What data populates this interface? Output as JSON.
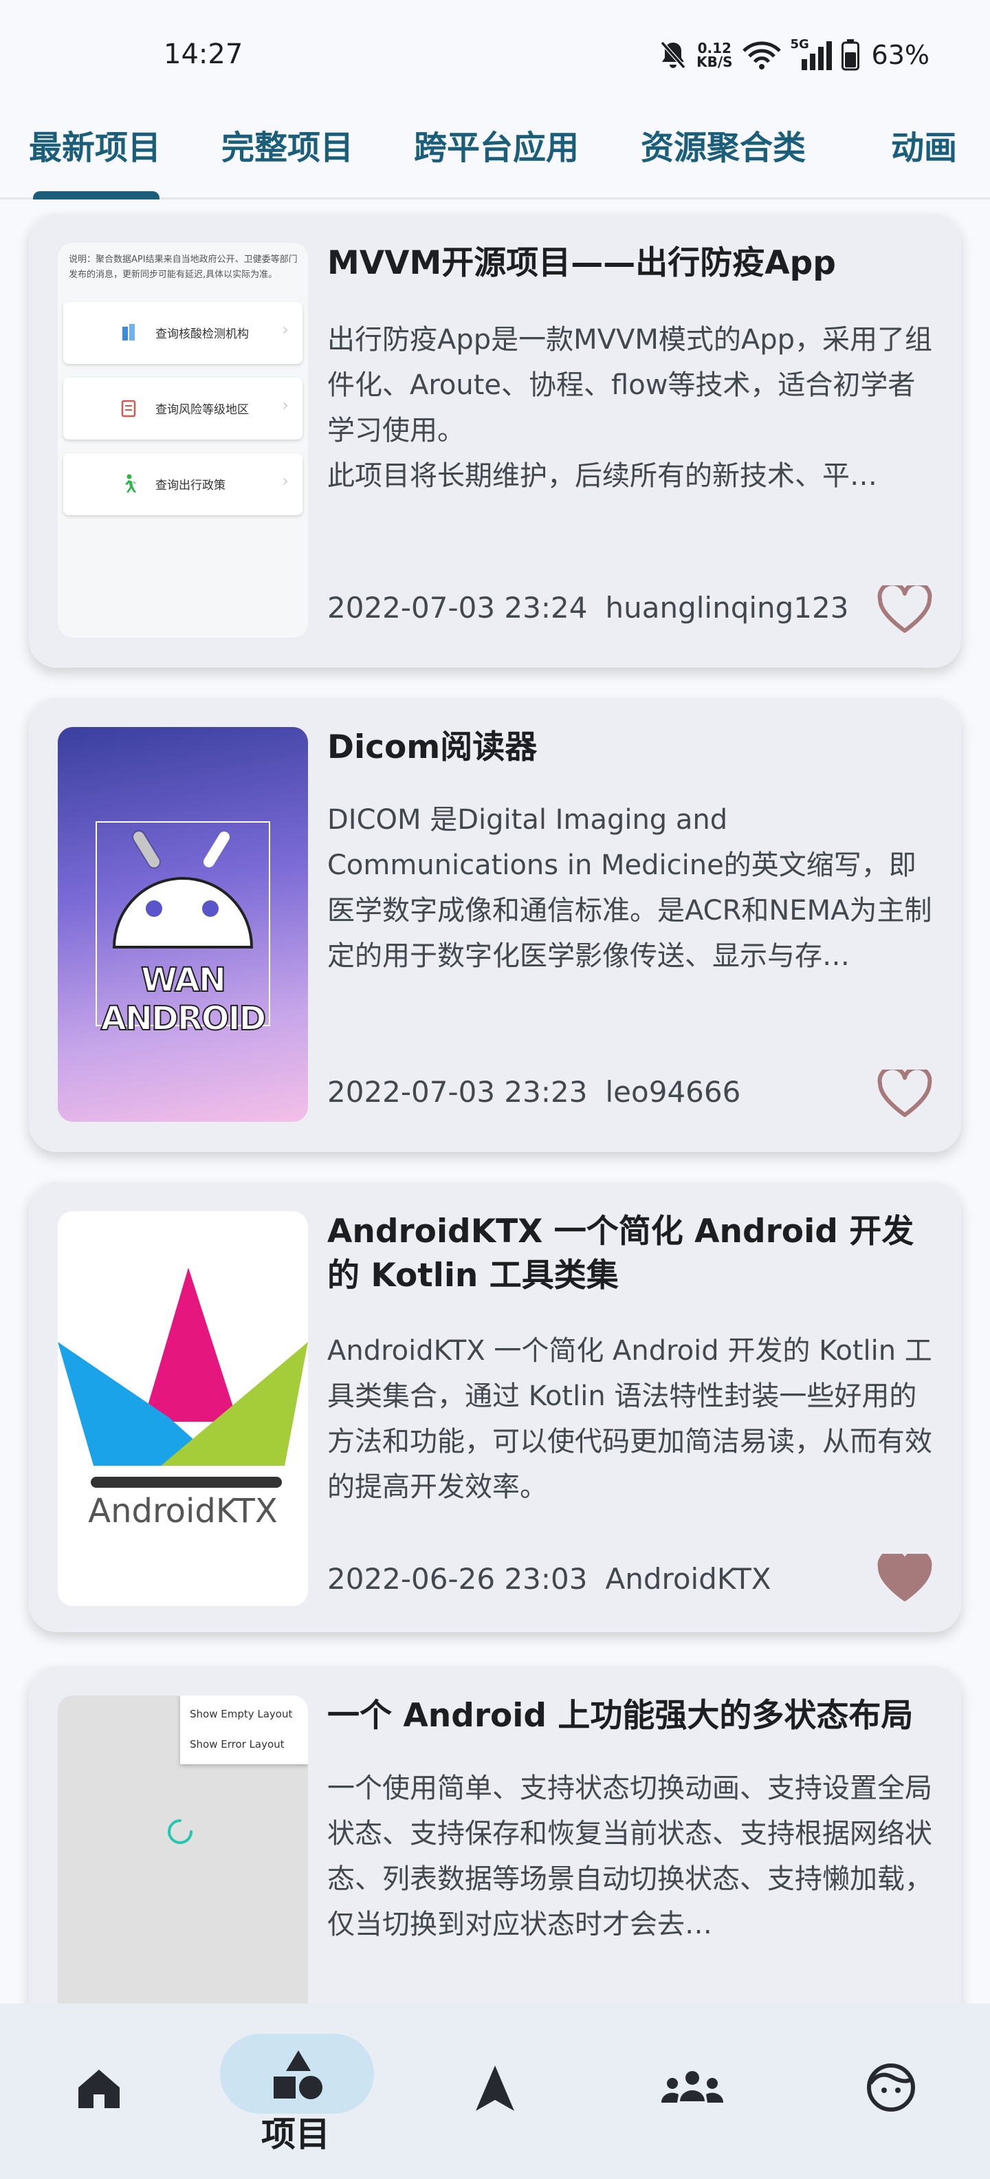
{
  "status_bar": {
    "time": "14:27",
    "net_speed_value": "0.12",
    "net_speed_unit": "KB/S",
    "cell_label": "5G",
    "battery": "63%"
  },
  "tabs": [
    {
      "label": "最新项目",
      "selected": true
    },
    {
      "label": "完整项目",
      "selected": false
    },
    {
      "label": "跨平台应用",
      "selected": false
    },
    {
      "label": "资源聚合类",
      "selected": false
    },
    {
      "label": "动画",
      "selected": false
    }
  ],
  "projects": [
    {
      "title": "MVVM开源项目——出行防疫App",
      "desc": "出行防疫App是一款MVVM模式的App，采用了组件化、Aroute、协程、flow等技术，适合初学者学习使用。\n此项目将长期维护，后续所有的新技术、平…",
      "date": "2022-07-03 23:24",
      "author": "huanglinqing123",
      "favorited": false,
      "thumb": {
        "note": "说明：聚合数据API结果来自当地政府公开、卫健委等部门发布的消息，更新同步可能有延迟,具体以实际为准。",
        "buttons": [
          "查询核酸检测机构",
          "查询风险等级地区",
          "查询出行政策"
        ]
      }
    },
    {
      "title": "Dicom阅读器",
      "desc": "DICOM 是Digital Imaging and Communications in Medicine的英文缩写，即医学数字成像和通信标准。是ACR和NEMA为主制定的用于数字化医学影像传送、显示与存…",
      "date": "2022-07-03 23:23",
      "author": "leo94666",
      "favorited": false,
      "thumb": {
        "logo_text": "WAN ANDROID"
      }
    },
    {
      "title": "AndroidKTX 一个简化 Android 开发的 Kotlin 工具类集",
      "desc": "AndroidKTX 一个简化 Android 开发的 Kotlin 工具类集合，通过 Kotlin 语法特性封装一些好用的方法和功能，可以使代码更加简洁易读，从而有效的提高开发效率。",
      "date": "2022-06-26 23:03",
      "author": "AndroidKTX",
      "favorited": true,
      "thumb": {
        "logo_text": "AndroidKTX"
      }
    },
    {
      "title": "一个 Android 上功能强大的多状态布局",
      "desc": "一个使用简单、支持状态切换动画、支持设置全局状态、支持保存和恢复当前状态、支持根据网络状态、列表数据等场景自动切换状态、支持懒加载，仅当切换到对应状态时才会去…",
      "date": "",
      "author": "",
      "favorited": false,
      "thumb": {
        "menu": [
          "Show Empty Layout",
          "Show Error Layout"
        ]
      }
    }
  ],
  "bottom_nav": {
    "items": [
      {
        "name": "home",
        "icon": "home-icon"
      },
      {
        "name": "project",
        "icon": "shapes-icon",
        "label": "项目",
        "selected": true
      },
      {
        "name": "navigation",
        "icon": "navigation-arrow-icon"
      },
      {
        "name": "community",
        "icon": "group-icon"
      },
      {
        "name": "profile",
        "icon": "face-icon"
      }
    ]
  },
  "colors": {
    "accent": "#1b5e7a",
    "heart": "#a67a7a",
    "card_bg": "#eceef3",
    "nav_pill": "#cce3f2"
  }
}
